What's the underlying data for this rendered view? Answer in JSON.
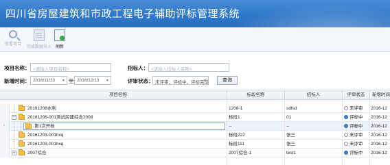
{
  "header": {
    "title": "四川省房屋建筑和市政工程电子辅助评标管理系统"
  },
  "toolbar": {
    "items": [
      {
        "label": "查看项目",
        "icon": "search-icon",
        "enabled": false
      },
      {
        "label": "完成数据导入",
        "icon": "document-icon",
        "enabled": false
      },
      {
        "label": "刷新",
        "icon": "refresh-icon",
        "enabled": true
      }
    ]
  },
  "filters": {
    "project_name_label": "项目名称：",
    "project_name_placeholder": "<请输入项目名称>",
    "bidder_label": "招标人：",
    "bidder_placeholder": "<请输入招标人名称>",
    "date_label": "新增时间：",
    "date_from": "2016/11/13",
    "date_sep": "至",
    "date_to": "2016/12/13",
    "status_label": "评审状态：",
    "status_value": "未评审，评标中，评标完成",
    "query_button": "查询"
  },
  "grid": {
    "columns": [
      "项目名称",
      "标段名称",
      "招标人",
      "评审状态",
      "新增时间"
    ],
    "rows": [
      {
        "name": "20161208水利",
        "section": "1208-1",
        "bidder": "sdfsd",
        "status": "未评审",
        "status_color": "#ffffff",
        "date": "2016-12",
        "level": 0,
        "expander": "",
        "selected": false
      },
      {
        "name": "20161206-001测试房建综合2008",
        "section": "标段1",
        "bidder": "01",
        "status": "评标中",
        "status_color": "#3b7fd0",
        "date": "2016-12",
        "level": 0,
        "expander": "−",
        "selected": false
      },
      {
        "name": "第1次开标",
        "section": "--",
        "bidder": "--",
        "status": "评标中",
        "status_color": "#3b7fd0",
        "date": "2016-12",
        "level": 1,
        "expander": "",
        "selected": true
      },
      {
        "name": "20161203-001hxq",
        "section": "标段222",
        "bidder": "张三",
        "status": "未评审",
        "status_color": "#ffffff",
        "date": "2016-12",
        "level": 0,
        "expander": "",
        "selected": false
      },
      {
        "name": "20161203-001hxq",
        "section": "标段111",
        "bidder": "张三",
        "status": "未评审",
        "status_color": "#ffffff",
        "date": "2016-12",
        "level": 0,
        "expander": "",
        "selected": false
      },
      {
        "name": "2007综合",
        "section": "2007综合-1",
        "bidder": "test1",
        "status": "评标中",
        "status_color": "#3b7fd0",
        "date": "2016-12",
        "level": 0,
        "expander": "+",
        "selected": false
      }
    ]
  }
}
